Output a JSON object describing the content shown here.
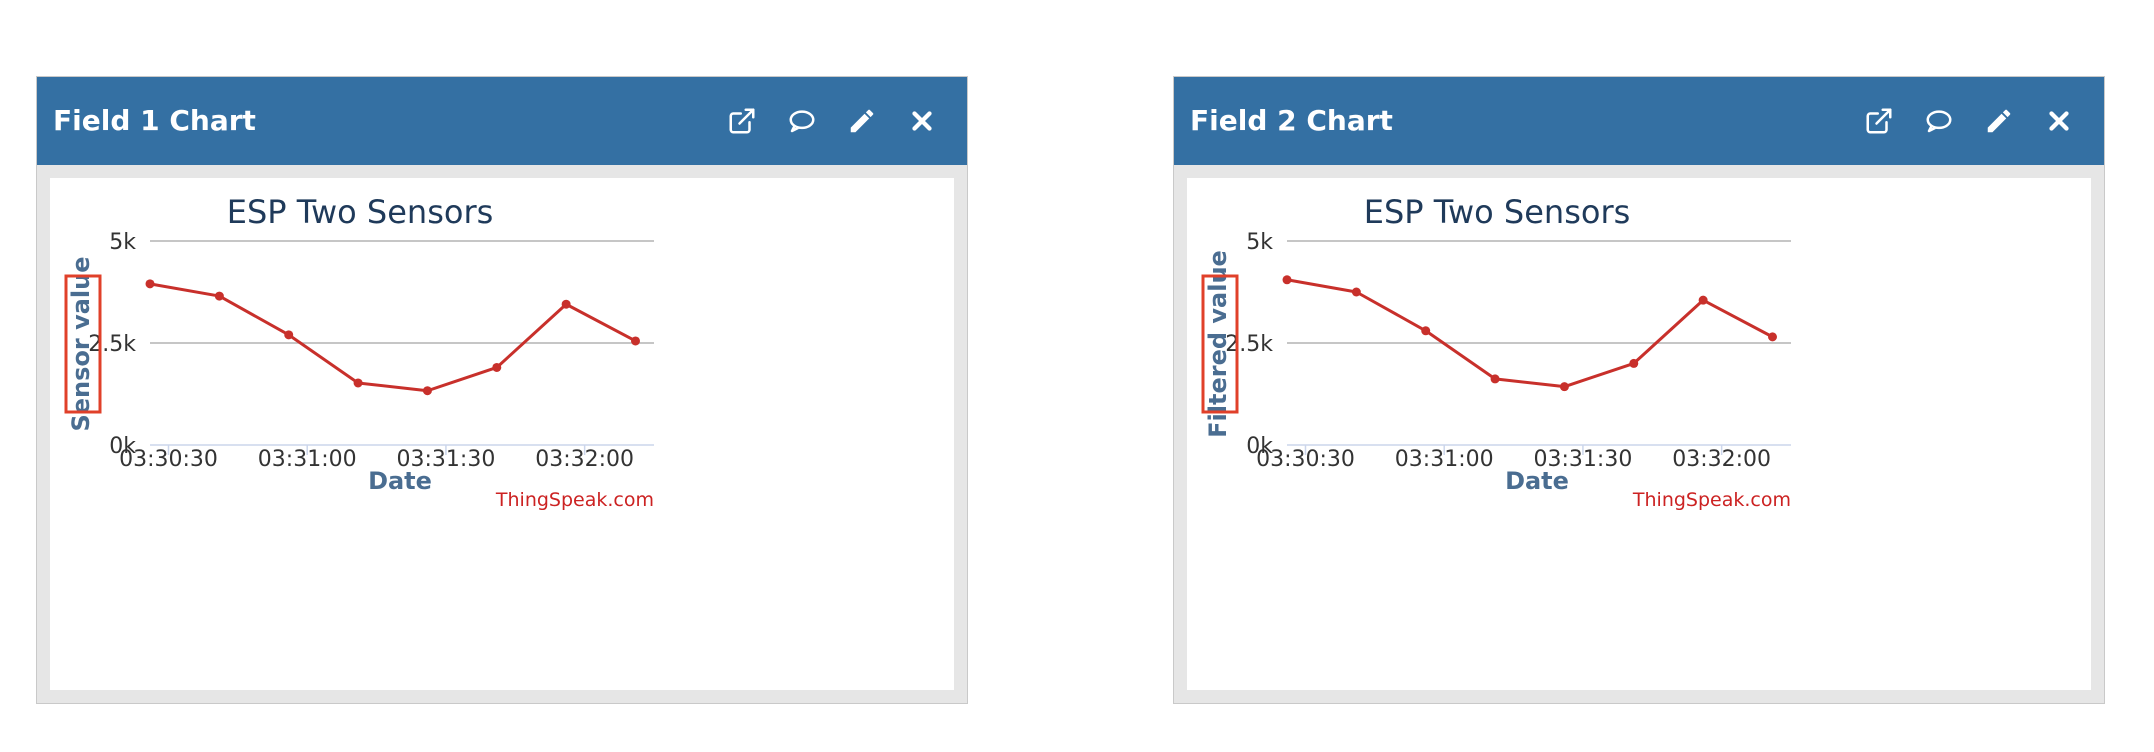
{
  "widgets": [
    {
      "title": "Field 1 Chart",
      "icons": [
        "external-link-icon",
        "comment-icon",
        "pencil-icon",
        "close-icon"
      ]
    },
    {
      "title": "Field 2 Chart",
      "icons": [
        "external-link-icon",
        "comment-icon",
        "pencil-icon",
        "close-icon"
      ]
    }
  ],
  "chart_data": [
    {
      "type": "line",
      "title": "ESP Two Sensors",
      "xlabel": "Date",
      "ylabel": "Sensor value",
      "x": [
        "03:30:26",
        "03:30:41",
        "03:30:56",
        "03:31:11",
        "03:31:26",
        "03:31:41",
        "03:31:56",
        "03:32:11"
      ],
      "values": [
        3950,
        3650,
        2700,
        1520,
        1330,
        1900,
        3450,
        2550
      ],
      "xticks": [
        "03:30:30",
        "03:31:00",
        "03:31:30",
        "03:32:00"
      ],
      "yticks": [
        "0k",
        "2.5k",
        "5k"
      ],
      "ylim": [
        0,
        5000
      ],
      "credit": "ThingSpeak.com",
      "line_color": "#c8302b",
      "grid": true
    },
    {
      "type": "line",
      "title": "ESP Two Sensors",
      "xlabel": "Date",
      "ylabel": "Filtered value",
      "x": [
        "03:30:26",
        "03:30:41",
        "03:30:56",
        "03:31:11",
        "03:31:26",
        "03:31:41",
        "03:31:56",
        "03:32:11"
      ],
      "values": [
        4050,
        3750,
        2800,
        1620,
        1430,
        2000,
        3550,
        2650
      ],
      "xticks": [
        "03:30:30",
        "03:31:00",
        "03:31:30",
        "03:32:00"
      ],
      "yticks": [
        "0k",
        "2.5k",
        "5k"
      ],
      "ylim": [
        0,
        5000
      ],
      "credit": "ThingSpeak.com",
      "line_color": "#c8302b",
      "grid": true
    }
  ]
}
